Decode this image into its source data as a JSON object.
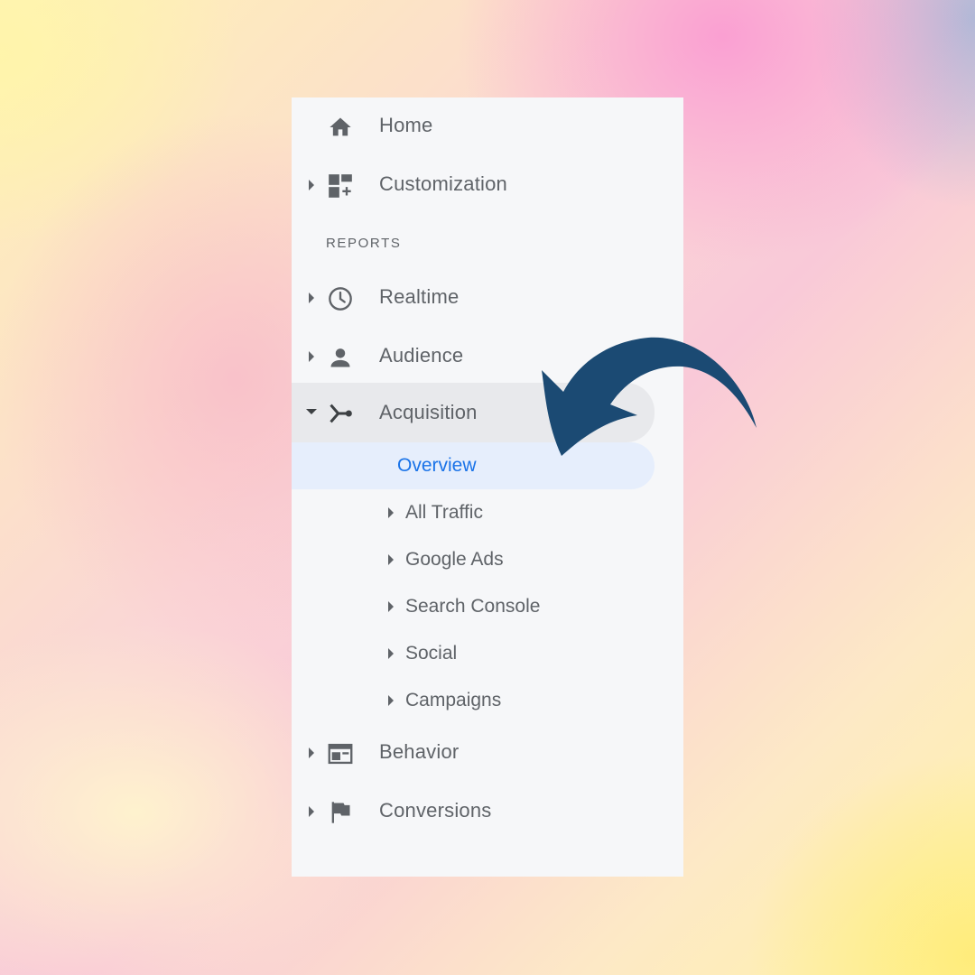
{
  "nav": {
    "home": "Home",
    "customization": "Customization",
    "section_reports": "REPORTS",
    "realtime": "Realtime",
    "audience": "Audience",
    "acquisition": "Acquisition",
    "acquisition_items": {
      "overview": "Overview",
      "all_traffic": "All Traffic",
      "google_ads": "Google Ads",
      "search_console": "Search Console",
      "social": "Social",
      "campaigns": "Campaigns"
    },
    "behavior": "Behavior",
    "conversions": "Conversions"
  },
  "icons": {
    "home": "home-icon",
    "customization": "dashboard-add-icon",
    "realtime": "clock-icon",
    "audience": "person-icon",
    "acquisition": "acquisition-branch-icon",
    "behavior": "browser-window-icon",
    "conversions": "flag-icon",
    "pointer": "curved-arrow-icon"
  },
  "colors": {
    "icon_gray": "#5f6368",
    "selected_text": "#1a73e8",
    "selected_bg": "#e6eefc",
    "active_bg": "#e8e9ec",
    "arrow": "#1b4a73"
  }
}
